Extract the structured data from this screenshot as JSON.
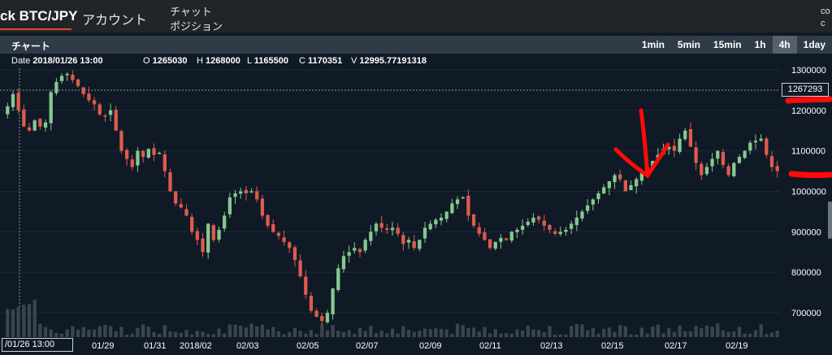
{
  "nav": {
    "brand": "ck BTC/JPY",
    "account": "アカウント",
    "chat": "チャット",
    "position": "ポジション",
    "edge_text_1": "co",
    "edge_text_2": "c"
  },
  "chart_header": {
    "title": "チャート",
    "timeframes": [
      {
        "label": "1min",
        "active": false
      },
      {
        "label": "5min",
        "active": false
      },
      {
        "label": "15min",
        "active": false
      },
      {
        "label": "1h",
        "active": false
      },
      {
        "label": "4h",
        "active": true
      },
      {
        "label": "1day",
        "active": false
      }
    ]
  },
  "ohlc": {
    "date_label": "Date",
    "date": "2018/01/26 13:00",
    "o_label": "O",
    "o": "1265030",
    "h_label": "H",
    "h": "1268000",
    "l_label": "L",
    "l": "1165500",
    "c_label": "C",
    "c": "1170351",
    "v_label": "V",
    "v": "12995.77191318"
  },
  "current_price_tag": "1267293",
  "crosshair_time_tag": "/01/26 13:00",
  "colors": {
    "background": "#0f1a26",
    "up": "#86c98e",
    "down": "#e05a4e",
    "annotation": "#ff0a0a",
    "grid": "#1c2a37"
  },
  "chart_data": {
    "type": "candlestick",
    "interval": "4h",
    "ylim": [
      640000,
      1340000
    ],
    "y_ticks": [
      "1300000",
      "1200000",
      "1100000",
      "1000000",
      "900000",
      "800000",
      "700000"
    ],
    "x_ticks": [
      "01/29",
      "01/31",
      "2018/02",
      "02/03",
      "02/05",
      "02/07",
      "02/09",
      "02/11",
      "02/13",
      "02/15",
      "02/17",
      "02/19"
    ],
    "close_path": [
      1210000,
      1240000,
      1200000,
      1160000,
      1150000,
      1175000,
      1160000,
      1170000,
      1245000,
      1270000,
      1285000,
      1290000,
      1275000,
      1260000,
      1240000,
      1225000,
      1215000,
      1190000,
      1185000,
      1200000,
      1150000,
      1100000,
      1080000,
      1060000,
      1100000,
      1085000,
      1105000,
      1090000,
      1095000,
      1050000,
      1000000,
      970000,
      960000,
      940000,
      900000,
      880000,
      850000,
      920000,
      880000,
      905000,
      940000,
      985000,
      995000,
      1000000,
      995000,
      1000000,
      980000,
      940000,
      915000,
      900000,
      890000,
      875000,
      860000,
      830000,
      790000,
      745000,
      705000,
      690000,
      680000,
      700000,
      760000,
      810000,
      840000,
      850000,
      860000,
      850000,
      880000,
      900000,
      920000,
      910000,
      905000,
      910000,
      895000,
      870000,
      880000,
      860000,
      880000,
      910000,
      920000,
      930000,
      935000,
      950000,
      970000,
      980000,
      985000,
      940000,
      915000,
      895000,
      880000,
      860000,
      875000,
      885000,
      880000,
      900000,
      905000,
      915000,
      925000,
      935000,
      930000,
      915000,
      905000,
      895000,
      900000,
      905000,
      920000,
      935000,
      950000,
      965000,
      980000,
      995000,
      1010000,
      1025000,
      1040000,
      1030000,
      1000000,
      1015000,
      1030000,
      1045000,
      1060000,
      1075000,
      1090000,
      1105000,
      1110000,
      1100000,
      1130000,
      1150000,
      1110000,
      1070000,
      1040000,
      1060000,
      1080000,
      1100000,
      1065000,
      1040000,
      1070000,
      1085000,
      1100000,
      1120000,
      1125000,
      1130000,
      1090000,
      1060000,
      1050000
    ]
  }
}
